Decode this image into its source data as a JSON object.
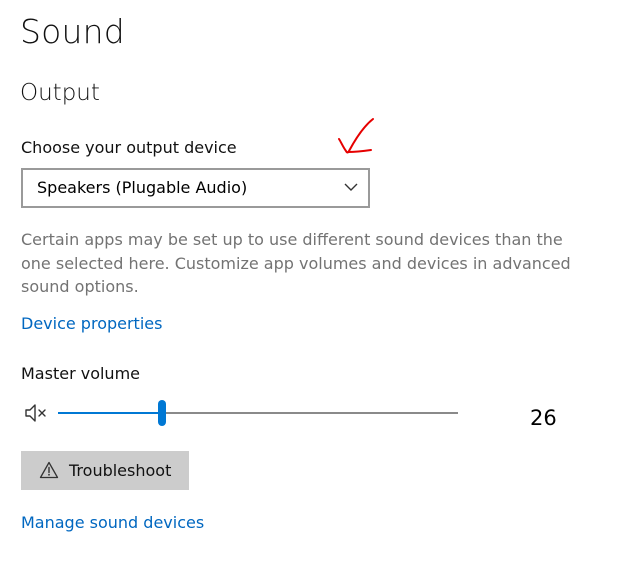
{
  "page": {
    "title": "Sound"
  },
  "output": {
    "section_title": "Output",
    "device_label": "Choose your output device",
    "selected_device": "Speakers (Plugable Audio)",
    "description": "Certain apps may be set up to use different sound devices than the one selected here. Customize app volumes and devices in advanced sound options.",
    "device_properties_link": "Device properties"
  },
  "volume": {
    "label": "Master volume",
    "value": 26,
    "icon": "speaker-muted-icon"
  },
  "troubleshoot": {
    "label": "Troubleshoot",
    "icon": "warning-icon"
  },
  "manage_devices_link": "Manage sound devices",
  "colors": {
    "accent": "#0078d4",
    "link": "#0067c0",
    "annotation": "#e60000",
    "muted_text": "#737373"
  }
}
